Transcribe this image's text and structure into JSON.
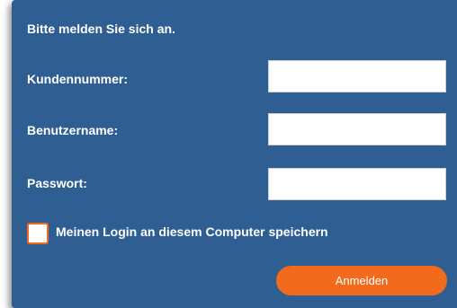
{
  "login": {
    "heading": "Bitte melden Sie sich an.",
    "fields": [
      {
        "label": "Kundennummer:",
        "value": "",
        "type": "text"
      },
      {
        "label": "Benutzername:",
        "value": "",
        "type": "text"
      },
      {
        "label": "Passwort:",
        "value": "",
        "type": "password"
      }
    ],
    "remember_label": "Meinen Login an diesem Computer speichern",
    "remember_checked": false,
    "submit_label": "Anmelden"
  },
  "colors": {
    "panel_background": "#2f5e92",
    "accent": "#f26b1d",
    "text": "#ffffff",
    "input_background": "#ffffff"
  }
}
